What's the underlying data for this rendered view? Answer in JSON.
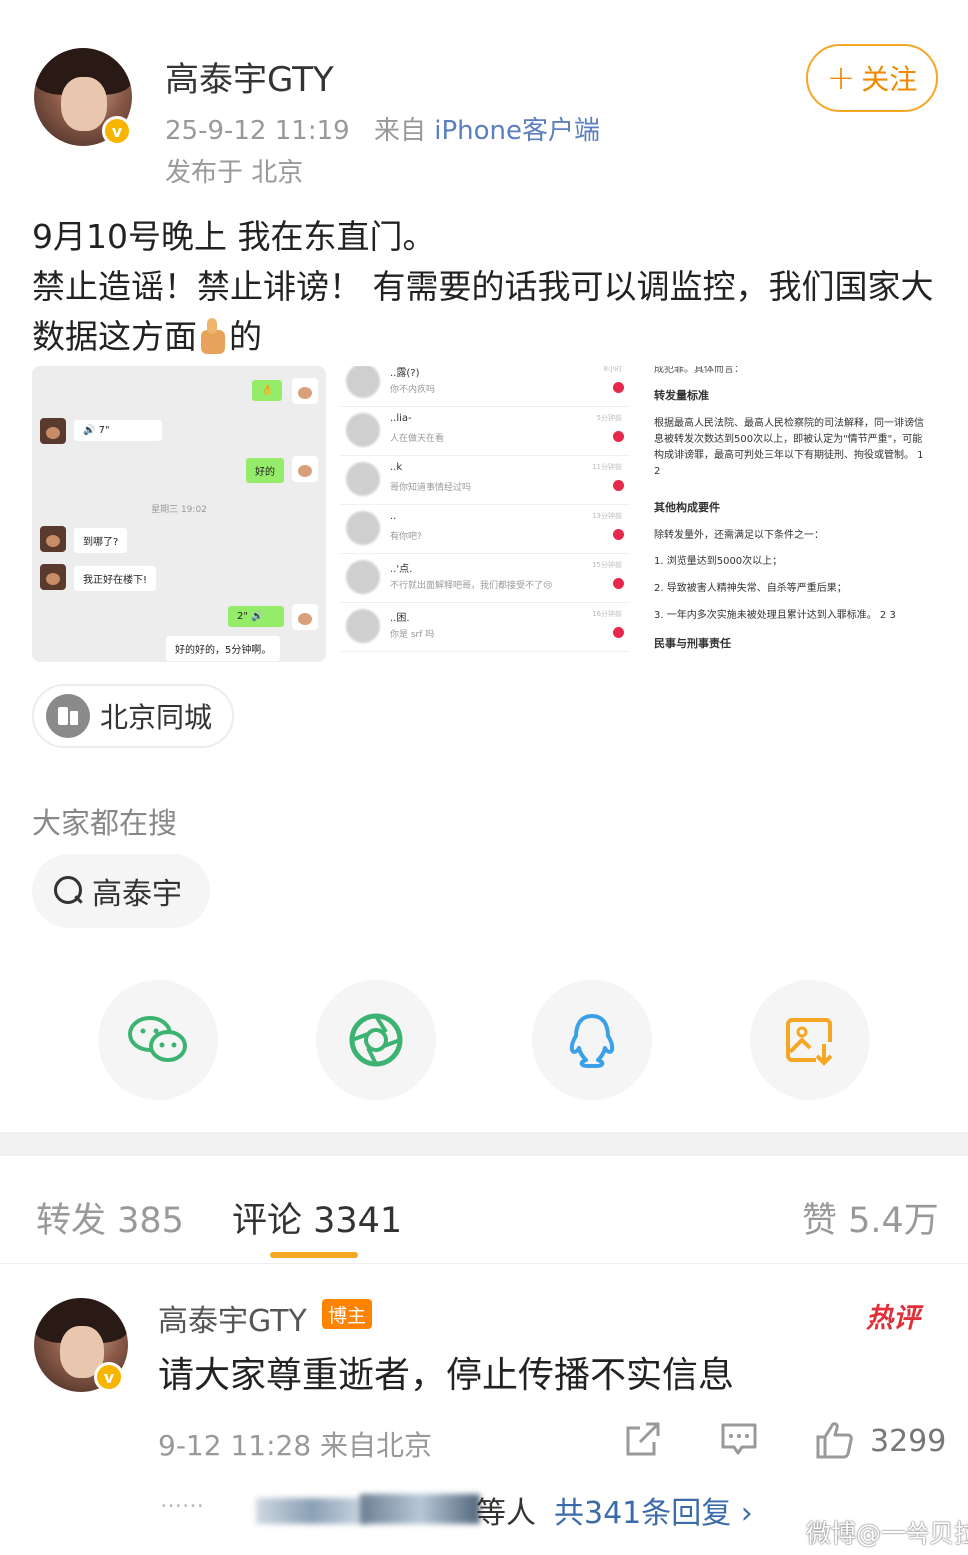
{
  "post": {
    "author_name": "高泰宇GTY",
    "time": "25-9-12 11:19",
    "source_prefix": "来自",
    "source": "iPhone客户端",
    "location": "发布于 北京",
    "follow_label": "关注",
    "text_line1": "9月10号晚上 我在东直门。",
    "text_line2": "禁止造谣！禁止诽谤！ 有需要的话我可以调监控，我们国家大数据这方面",
    "text_line2_end": "的"
  },
  "images": {
    "chat": {
      "out_1": "👌",
      "in_voice": "🔊 7\"",
      "out_2": "好的",
      "time": "星期三 19:02",
      "in_2": "到哪了?",
      "in_3": "我正好在楼下!",
      "out_voice": "2\" 🔊",
      "out_3": "好的好的，5分钟啊。"
    },
    "contacts": [
      {
        "name": "..露(?)",
        "msg": "你不内疚吗",
        "time": "8小时"
      },
      {
        "name": "..lia-",
        "msg": "人在做天在看",
        "time": "5分钟前"
      },
      {
        "name": "..k",
        "msg": "哥你知道事情经过吗",
        "time": "11分钟前"
      },
      {
        "name": "..",
        "msg": "有你吧?",
        "time": "13分钟前"
      },
      {
        "name": "..'点.",
        "msg": "不行就出面解释吧哥，我们都接受不了😢",
        "time": "15分钟前"
      },
      {
        "name": "..困.",
        "msg": "你是 srf 吗",
        "time": "16分钟前"
      }
    ],
    "law": {
      "top": "成犯罪。具体而言：",
      "h1": "转发量标准",
      "p1": "根据最高人民法院、最高人民检察院的司法解释，同一诽谤信息被转发次数达到500次以上，即被认定为\"情节严重\"，可能构成诽谤罪，最高可判处三年以下有期徒刑、拘役或管制。 1 2",
      "h2": "其他构成要件",
      "p2": "除转发量外，还需满足以下条件之一：",
      "i1": "1. 浏览量达到5000次以上；",
      "i2": "2. 导致被害人精神失常、自杀等严重后果；",
      "i3": "3. 一年内多次实施未被处理且累计达到入罪标准。 2 3",
      "h3": "民事与刑事责任"
    }
  },
  "place_tag": "北京同城",
  "search": {
    "title": "大家都在搜",
    "chip": "高泰宇"
  },
  "share": [
    "wechat-icon",
    "moments-icon",
    "qq-icon",
    "save-image-icon"
  ],
  "tabs": {
    "repost": "转发 385",
    "comment": "评论 3341",
    "like": "赞 5.4万"
  },
  "comment": {
    "author": "高泰宇GTY",
    "badge": "博主",
    "hot": "热评",
    "text": "请大家尊重逝者，停止传播不实信息",
    "meta": "9-12 11:28 来自北京",
    "like_count": "3299",
    "dots": "……",
    "reply_who": "等人",
    "reply_total": "共341条回复 ›"
  },
  "watermark": "微博@一쑥贝拉",
  "colors": {
    "accent": "#f5a623",
    "link": "#3b6ba8",
    "hot": "#e0303a",
    "wechat": "#3cb371",
    "qq": "#3aa0e8"
  }
}
